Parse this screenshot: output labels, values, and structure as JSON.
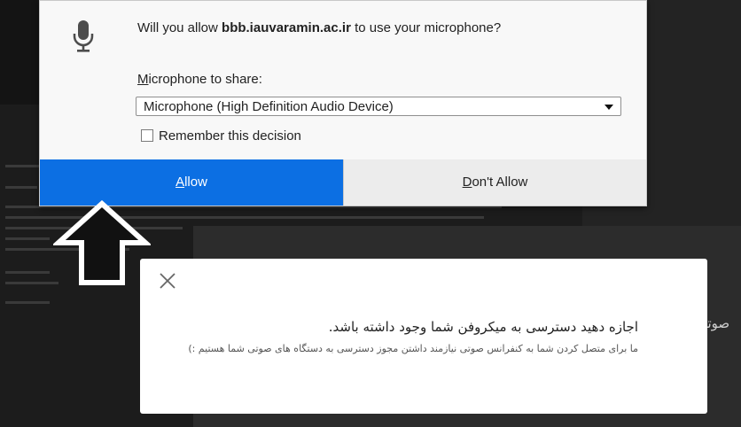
{
  "permission_prompt": {
    "message_before": "Will you allow ",
    "domain": "bbb.iauvaramin.ac.ir",
    "message_after": " to use your microphone?",
    "share_label_first": "M",
    "share_label_rest": "icrophone to share:",
    "selected_device": "Microphone (High Definition Audio Device)",
    "remember_label": "Remember this decision",
    "allow_first": "A",
    "allow_rest": "llow",
    "deny_first": "D",
    "deny_rest": "on't Allow",
    "allow_color": "#0c6fe3",
    "icon": "microphone-icon"
  },
  "background": {
    "partial_text": "صوتی"
  },
  "modal": {
    "title": "اجازه دهید دسترسی به میکروفن شما وجود داشته باشد.",
    "body": "ما برای متصل کردن شما به کنفرانس صوتی نیازمند داشتن مجوز دسترسی به دستگاه های صوتی شما هستیم :)",
    "close_icon": "close-icon"
  },
  "annotation": {
    "icon": "up-arrow-icon"
  }
}
